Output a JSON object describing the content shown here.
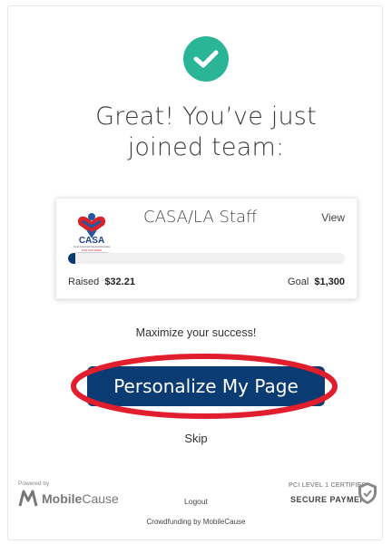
{
  "headline": [
    "Great! You’ve just",
    "joined team:"
  ],
  "team": {
    "name": "CASA/LA Staff",
    "view_label": "View",
    "raised_label": "Raised",
    "raised_value": "$32.21",
    "goal_label": "Goal",
    "goal_value": "$1,300",
    "progress_fraction": 0.025
  },
  "logo_text": {
    "wordmark": "CASA",
    "subtitle": "Court Appointed Special Advocates",
    "tagline": "FOR CHILDREN",
    "bottom": "CASA OF LOS ANGELES"
  },
  "maximize_text": "Maximize your success!",
  "cta_label": "Personalize My Page",
  "skip_label": "Skip",
  "footer": {
    "powered_by": "Powered by",
    "brand_bold": "Mobile",
    "brand_light": "Cause",
    "logout": "Logout",
    "crowdfunding": "Crowdfunding by MobileCause",
    "pci_line": "PCI LEVEL 1 CERTIFIED",
    "secure_line": "SECURE PAYMENT"
  },
  "colors": {
    "check_green": "#2bb597",
    "primary_navy": "#0b3b73",
    "highlight_red": "#e01e2d"
  },
  "icons": {
    "success": "check-circle-icon",
    "security": "shield-check-icon",
    "brand": "mobilecause-logo-icon"
  }
}
